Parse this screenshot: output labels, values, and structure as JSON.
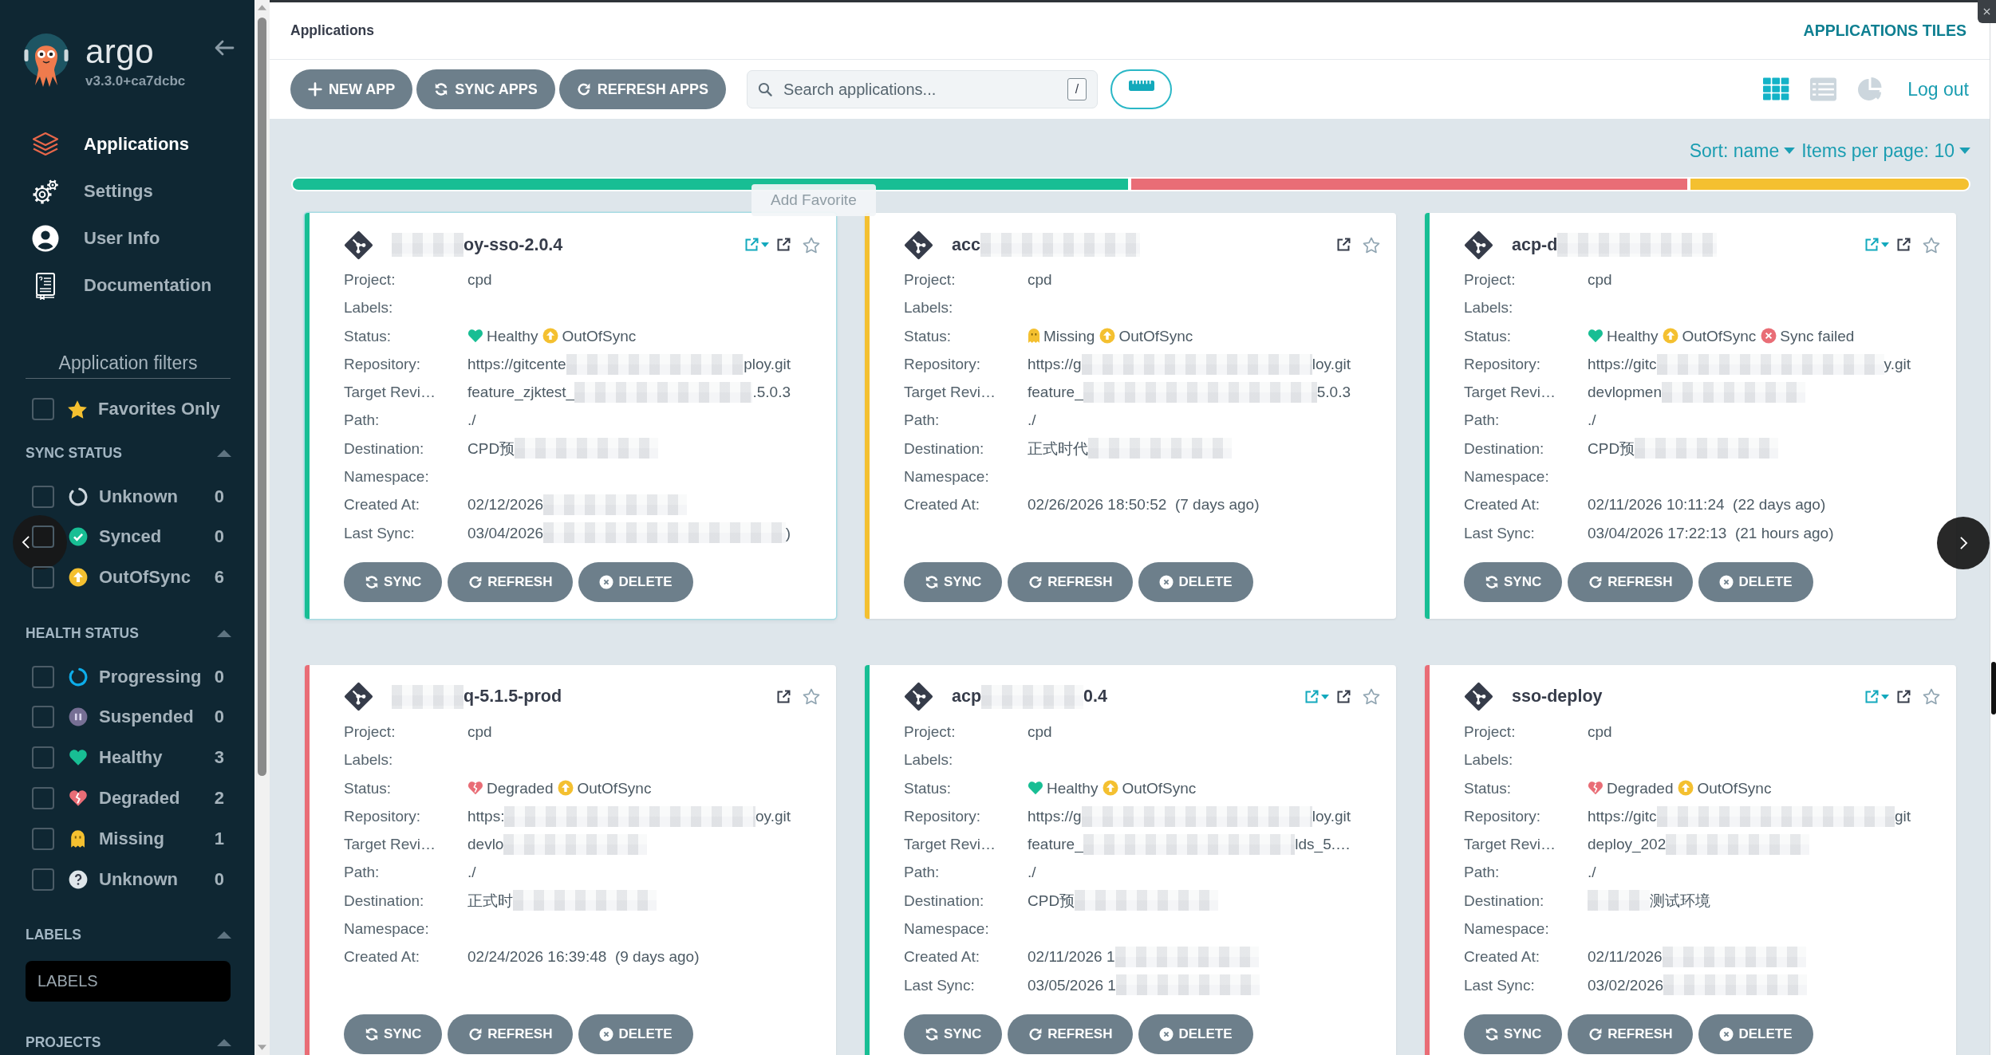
{
  "sidebar": {
    "brand": {
      "name": "argo",
      "version": "v3.3.0+ca7dcbc"
    },
    "nav": [
      {
        "kind": "applications",
        "label": "Applications",
        "selected": true
      },
      {
        "kind": "settings",
        "label": "Settings",
        "selected": false
      },
      {
        "kind": "user-info",
        "label": "User Info",
        "selected": false
      },
      {
        "kind": "documentation",
        "label": "Documentation",
        "selected": false
      }
    ],
    "filters_title": "Application filters",
    "favorites": {
      "label": "Favorites Only",
      "checked": false
    },
    "sections": [
      {
        "kind": "checklist",
        "title": "SYNC STATUS",
        "expanded": true,
        "items": [
          {
            "kind": "unknown-sync",
            "label": "Unknown",
            "count": "0",
            "checked": false
          },
          {
            "kind": "synced",
            "label": "Synced",
            "count": "0",
            "checked": false
          },
          {
            "kind": "out-of-sync",
            "label": "OutOfSync",
            "count": "6",
            "checked": false
          }
        ]
      },
      {
        "kind": "checklist",
        "title": "HEALTH STATUS",
        "expanded": true,
        "items": [
          {
            "kind": "progressing",
            "label": "Progressing",
            "count": "0",
            "checked": false
          },
          {
            "kind": "suspended",
            "label": "Suspended",
            "count": "0",
            "checked": false
          },
          {
            "kind": "healthy",
            "label": "Healthy",
            "count": "3",
            "checked": false
          },
          {
            "kind": "degraded",
            "label": "Degraded",
            "count": "2",
            "checked": false
          },
          {
            "kind": "missing",
            "label": "Missing",
            "count": "1",
            "checked": false
          },
          {
            "kind": "unknown-health",
            "label": "Unknown",
            "count": "0",
            "checked": false
          }
        ]
      },
      {
        "kind": "input",
        "title": "LABELS",
        "expanded": true,
        "placeholder": "LABELS"
      },
      {
        "kind": "header",
        "title": "PROJECTS",
        "expanded": true
      }
    ]
  },
  "header": {
    "title": "Applications",
    "view_title": "APPLICATIONS TILES"
  },
  "toolbar": {
    "actions": [
      {
        "kind": "add",
        "label": "NEW APP"
      },
      {
        "kind": "sync",
        "label": "SYNC APPS"
      },
      {
        "kind": "refresh",
        "label": "REFRESH APPS"
      }
    ],
    "search": {
      "placeholder": "Search applications...",
      "shortcut": "/"
    },
    "views": [
      {
        "kind": "tiles",
        "selected": true
      },
      {
        "kind": "list",
        "selected": false
      },
      {
        "kind": "summary",
        "selected": false
      }
    ],
    "logout": "Log out"
  },
  "sort": {
    "sort_label": "Sort: name",
    "page_size_label": "Items per page: 10"
  },
  "health_summary": {
    "segments": [
      {
        "kind": "healthy"
      },
      {
        "kind": "degraded"
      },
      {
        "kind": "missing"
      }
    ]
  },
  "tooltip": {
    "text": "Add Favorite"
  },
  "cards": [
    {
      "title": [
        {
          "kind": "redacted"
        },
        {
          "kind": "text",
          "text": "oy-sso-2.0.4"
        }
      ],
      "hovered": true,
      "url_menu": true,
      "favorite": false,
      "fields": [
        {
          "kind": "text",
          "label": "Project:",
          "parts": [
            {
              "kind": "text",
              "text": "cpd"
            }
          ]
        },
        {
          "kind": "text",
          "label": "Labels:"
        },
        {
          "kind": "status",
          "label": "Status:",
          "badges": [
            {
              "kind": "healthy",
              "text": "Healthy"
            },
            {
              "kind": "out-of-sync",
              "text": "OutOfSync"
            }
          ]
        },
        {
          "kind": "text",
          "label": "Repository:",
          "parts": [
            {
              "kind": "text",
              "text": "https://gitcente"
            },
            {
              "kind": "redacted"
            },
            {
              "kind": "text",
              "text": "ploy.git"
            }
          ]
        },
        {
          "kind": "text",
          "label": "Target Revi…",
          "parts": [
            {
              "kind": "text",
              "text": "feature_zjktest_"
            },
            {
              "kind": "redacted"
            },
            {
              "kind": "text",
              "text": ".5.0.3"
            }
          ]
        },
        {
          "kind": "text",
          "label": "Path:",
          "parts": [
            {
              "kind": "text",
              "text": "./"
            }
          ]
        },
        {
          "kind": "text",
          "label": "Destination:",
          "parts": [
            {
              "kind": "text",
              "text": "CPD预"
            },
            {
              "kind": "redacted"
            }
          ]
        },
        {
          "kind": "text",
          "label": "Namespace:"
        },
        {
          "kind": "text",
          "label": "Created At:",
          "parts": [
            {
              "kind": "text",
              "text": "02/12/2026"
            },
            {
              "kind": "redacted"
            }
          ]
        },
        {
          "kind": "text",
          "label": "Last Sync:",
          "parts": [
            {
              "kind": "text",
              "text": "03/04/2026"
            },
            {
              "kind": "redacted"
            },
            {
              "kind": "text",
              "text": ")"
            }
          ]
        }
      ],
      "buttons": [
        {
          "kind": "sync",
          "label": "SYNC"
        },
        {
          "kind": "refresh",
          "label": "REFRESH"
        },
        {
          "kind": "delete",
          "label": "DELETE"
        }
      ]
    },
    {
      "title": [
        {
          "kind": "text",
          "text": "acc"
        },
        {
          "kind": "redacted"
        }
      ],
      "hovered": false,
      "url_menu": false,
      "favorite": false,
      "fields": [
        {
          "kind": "text",
          "label": "Project:",
          "parts": [
            {
              "kind": "text",
              "text": "cpd"
            }
          ]
        },
        {
          "kind": "text",
          "label": "Labels:"
        },
        {
          "kind": "status",
          "label": "Status:",
          "badges": [
            {
              "kind": "missing",
              "text": "Missing"
            },
            {
              "kind": "out-of-sync",
              "text": "OutOfSync"
            }
          ]
        },
        {
          "kind": "text",
          "label": "Repository:",
          "parts": [
            {
              "kind": "text",
              "text": "https://g"
            },
            {
              "kind": "redacted"
            },
            {
              "kind": "text",
              "text": "loy.git"
            }
          ]
        },
        {
          "kind": "text",
          "label": "Target Revi…",
          "parts": [
            {
              "kind": "text",
              "text": "feature_"
            },
            {
              "kind": "redacted"
            },
            {
              "kind": "text",
              "text": "5.0.3"
            }
          ]
        },
        {
          "kind": "text",
          "label": "Path:",
          "parts": [
            {
              "kind": "text",
              "text": "./"
            }
          ]
        },
        {
          "kind": "text",
          "label": "Destination:",
          "parts": [
            {
              "kind": "text",
              "text": "正式时代"
            },
            {
              "kind": "redacted"
            }
          ]
        },
        {
          "kind": "text",
          "label": "Namespace:"
        },
        {
          "kind": "text",
          "label": "Created At:",
          "parts": [
            {
              "kind": "text",
              "text": "02/26/2026 18:50:52  (7 days ago)"
            }
          ]
        }
      ],
      "buttons": [
        {
          "kind": "sync",
          "label": "SYNC"
        },
        {
          "kind": "refresh",
          "label": "REFRESH"
        },
        {
          "kind": "delete",
          "label": "DELETE"
        }
      ]
    },
    {
      "title": [
        {
          "kind": "text",
          "text": "acp-d"
        },
        {
          "kind": "redacted"
        }
      ],
      "hovered": false,
      "url_menu": true,
      "favorite": false,
      "fields": [
        {
          "kind": "text",
          "label": "Project:",
          "parts": [
            {
              "kind": "text",
              "text": "cpd"
            }
          ]
        },
        {
          "kind": "text",
          "label": "Labels:"
        },
        {
          "kind": "status",
          "label": "Status:",
          "badges": [
            {
              "kind": "healthy",
              "text": "Healthy"
            },
            {
              "kind": "out-of-sync",
              "text": "OutOfSync"
            },
            {
              "kind": "sync-failed",
              "text": "Sync failed"
            }
          ]
        },
        {
          "kind": "text",
          "label": "Repository:",
          "parts": [
            {
              "kind": "text",
              "text": "https://gitc"
            },
            {
              "kind": "redacted"
            },
            {
              "kind": "text",
              "text": "y.git"
            }
          ]
        },
        {
          "kind": "text",
          "label": "Target Revi…",
          "parts": [
            {
              "kind": "text",
              "text": "devlopmen"
            },
            {
              "kind": "redacted"
            }
          ]
        },
        {
          "kind": "text",
          "label": "Path:",
          "parts": [
            {
              "kind": "text",
              "text": "./"
            }
          ]
        },
        {
          "kind": "text",
          "label": "Destination:",
          "parts": [
            {
              "kind": "text",
              "text": "CPD预"
            },
            {
              "kind": "redacted"
            }
          ]
        },
        {
          "kind": "text",
          "label": "Namespace:"
        },
        {
          "kind": "text",
          "label": "Created At:",
          "parts": [
            {
              "kind": "text",
              "text": "02/11/2026 10:11:24  (22 days ago)"
            }
          ]
        },
        {
          "kind": "text",
          "label": "Last Sync:",
          "parts": [
            {
              "kind": "text",
              "text": "03/04/2026 17:22:13  (21 hours ago)"
            }
          ]
        }
      ],
      "buttons": [
        {
          "kind": "sync",
          "label": "SYNC"
        },
        {
          "kind": "refresh",
          "label": "REFRESH"
        },
        {
          "kind": "delete",
          "label": "DELETE"
        }
      ]
    },
    {
      "title": [
        {
          "kind": "redacted"
        },
        {
          "kind": "text",
          "text": "q-5.1.5-prod"
        }
      ],
      "hovered": false,
      "url_menu": false,
      "favorite": false,
      "fields": [
        {
          "kind": "text",
          "label": "Project:",
          "parts": [
            {
              "kind": "text",
              "text": "cpd"
            }
          ]
        },
        {
          "kind": "text",
          "label": "Labels:"
        },
        {
          "kind": "status",
          "label": "Status:",
          "badges": [
            {
              "kind": "degraded",
              "text": "Degraded"
            },
            {
              "kind": "out-of-sync",
              "text": "OutOfSync"
            }
          ]
        },
        {
          "kind": "text",
          "label": "Repository:",
          "parts": [
            {
              "kind": "text",
              "text": "https:"
            },
            {
              "kind": "redacted"
            },
            {
              "kind": "text",
              "text": "oy.git"
            }
          ]
        },
        {
          "kind": "text",
          "label": "Target Revi…",
          "parts": [
            {
              "kind": "text",
              "text": "devlo"
            },
            {
              "kind": "redacted"
            }
          ]
        },
        {
          "kind": "text",
          "label": "Path:",
          "parts": [
            {
              "kind": "text",
              "text": "./"
            }
          ]
        },
        {
          "kind": "text",
          "label": "Destination:",
          "parts": [
            {
              "kind": "text",
              "text": "正式时"
            },
            {
              "kind": "redacted"
            }
          ]
        },
        {
          "kind": "text",
          "label": "Namespace:"
        },
        {
          "kind": "text",
          "label": "Created At:",
          "parts": [
            {
              "kind": "text",
              "text": "02/24/2026 16:39:48  (9 days ago)"
            }
          ]
        }
      ],
      "buttons": [
        {
          "kind": "sync",
          "label": "SYNC"
        },
        {
          "kind": "refresh",
          "label": "REFRESH"
        },
        {
          "kind": "delete",
          "label": "DELETE"
        }
      ]
    },
    {
      "title": [
        {
          "kind": "text",
          "text": "acp"
        },
        {
          "kind": "redacted"
        },
        {
          "kind": "text",
          "text": "0.4"
        }
      ],
      "hovered": false,
      "url_menu": true,
      "favorite": false,
      "fields": [
        {
          "kind": "text",
          "label": "Project:",
          "parts": [
            {
              "kind": "text",
              "text": "cpd"
            }
          ]
        },
        {
          "kind": "text",
          "label": "Labels:"
        },
        {
          "kind": "status",
          "label": "Status:",
          "badges": [
            {
              "kind": "healthy",
              "text": "Healthy"
            },
            {
              "kind": "out-of-sync",
              "text": "OutOfSync"
            }
          ]
        },
        {
          "kind": "text",
          "label": "Repository:",
          "parts": [
            {
              "kind": "text",
              "text": "https://g"
            },
            {
              "kind": "redacted"
            },
            {
              "kind": "text",
              "text": "loy.git"
            }
          ]
        },
        {
          "kind": "text",
          "label": "Target Revi…",
          "parts": [
            {
              "kind": "text",
              "text": "feature_"
            },
            {
              "kind": "redacted"
            },
            {
              "kind": "text",
              "text": "lds_5.…"
            }
          ]
        },
        {
          "kind": "text",
          "label": "Path:",
          "parts": [
            {
              "kind": "text",
              "text": "./"
            }
          ]
        },
        {
          "kind": "text",
          "label": "Destination:",
          "parts": [
            {
              "kind": "text",
              "text": "CPD预"
            },
            {
              "kind": "redacted"
            }
          ]
        },
        {
          "kind": "text",
          "label": "Namespace:"
        },
        {
          "kind": "text",
          "label": "Created At:",
          "parts": [
            {
              "kind": "text",
              "text": "02/11/2026 1"
            },
            {
              "kind": "redacted"
            }
          ]
        },
        {
          "kind": "text",
          "label": "Last Sync:",
          "parts": [
            {
              "kind": "text",
              "text": "03/05/2026 1"
            },
            {
              "kind": "redacted"
            }
          ]
        }
      ],
      "buttons": [
        {
          "kind": "sync",
          "label": "SYNC"
        },
        {
          "kind": "refresh",
          "label": "REFRESH"
        },
        {
          "kind": "delete",
          "label": "DELETE"
        }
      ]
    },
    {
      "title": [
        {
          "kind": "text",
          "text": "sso-deploy"
        }
      ],
      "hovered": false,
      "url_menu": true,
      "favorite": false,
      "fields": [
        {
          "kind": "text",
          "label": "Project:",
          "parts": [
            {
              "kind": "text",
              "text": "cpd"
            }
          ]
        },
        {
          "kind": "text",
          "label": "Labels:"
        },
        {
          "kind": "status",
          "label": "Status:",
          "badges": [
            {
              "kind": "degraded",
              "text": "Degraded"
            },
            {
              "kind": "out-of-sync",
              "text": "OutOfSync"
            }
          ]
        },
        {
          "kind": "text",
          "label": "Repository:",
          "parts": [
            {
              "kind": "text",
              "text": "https://gitc"
            },
            {
              "kind": "redacted"
            },
            {
              "kind": "text",
              "text": "git"
            }
          ]
        },
        {
          "kind": "text",
          "label": "Target Revi…",
          "parts": [
            {
              "kind": "text",
              "text": "deploy_202"
            },
            {
              "kind": "redacted"
            }
          ]
        },
        {
          "kind": "text",
          "label": "Path:",
          "parts": [
            {
              "kind": "text",
              "text": "./"
            }
          ]
        },
        {
          "kind": "text",
          "label": "Destination:",
          "parts": [
            {
              "kind": "redacted"
            },
            {
              "kind": "text",
              "text": "测试环境"
            }
          ]
        },
        {
          "kind": "text",
          "label": "Namespace:"
        },
        {
          "kind": "text",
          "label": "Created At:",
          "parts": [
            {
              "kind": "text",
              "text": "02/11/2026"
            },
            {
              "kind": "redacted"
            }
          ]
        },
        {
          "kind": "text",
          "label": "Last Sync:",
          "parts": [
            {
              "kind": "text",
              "text": "03/02/2026"
            },
            {
              "kind": "redacted"
            }
          ]
        }
      ],
      "buttons": [
        {
          "kind": "sync",
          "label": "SYNC"
        },
        {
          "kind": "refresh",
          "label": "REFRESH"
        },
        {
          "kind": "delete",
          "label": "DELETE"
        }
      ]
    }
  ]
}
